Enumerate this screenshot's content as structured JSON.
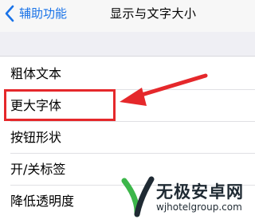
{
  "navbar": {
    "back_label": "辅助功能",
    "title": "显示与文字大小"
  },
  "settings": {
    "items": [
      {
        "label": "粗体文本"
      },
      {
        "label": "更大字体"
      },
      {
        "label": "按钮形状"
      },
      {
        "label": "开/关标签"
      },
      {
        "label": "降低透明度"
      }
    ]
  },
  "annotation": {
    "color": "#e5282b",
    "highlighted_item": "更大字体"
  },
  "watermark": {
    "text": "无极安卓网",
    "url": "wjhotelgroup.com"
  },
  "colors": {
    "accent": "#1a73e8",
    "watermark_green": "#3cb64a"
  }
}
